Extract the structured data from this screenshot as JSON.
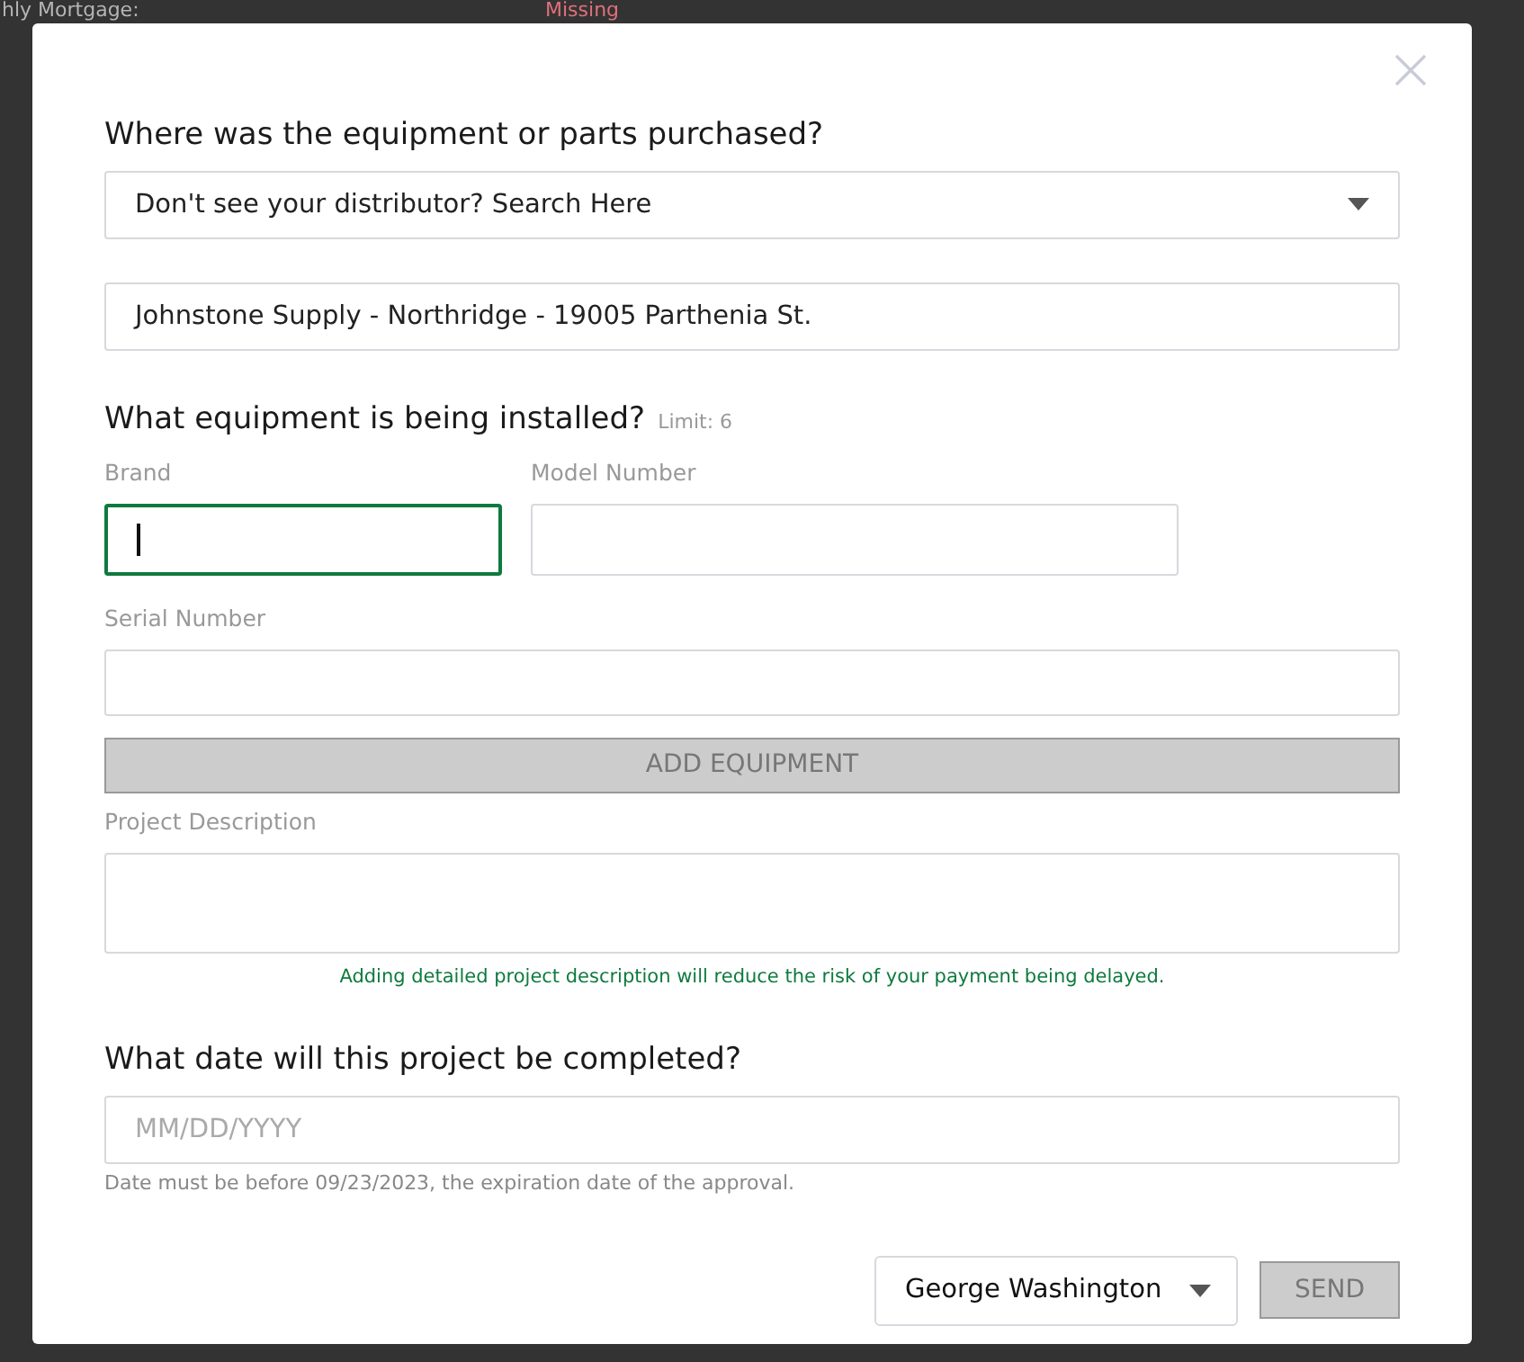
{
  "background": {
    "label": "hly Mortgage:",
    "status": "Missing"
  },
  "purchase": {
    "heading": "Where was the equipment or parts purchased?",
    "distributor_select": "Don't see your distributor? Search Here",
    "distributor_value": "Johnstone Supply - Northridge - 19005 Parthenia St."
  },
  "equipment": {
    "heading": "What equipment is being installed?",
    "limit": "Limit: 6",
    "fields": [
      {
        "label": "Brand",
        "focused": true
      },
      {
        "label": "Model Number",
        "focused": false
      },
      {
        "label": "Serial Number",
        "focused": false
      }
    ],
    "add_button": {
      "label": "ADD EQUIPMENT",
      "disabled": true
    }
  },
  "description": {
    "label": "Project Description",
    "hint": "Adding detailed project description will reduce the risk of your payment being delayed."
  },
  "completion": {
    "heading": "What date will this project be completed?",
    "placeholder": "MM/DD/YYYY",
    "note": "Date must be before 09/23/2023, the expiration date of the approval."
  },
  "footer": {
    "person": "George Washington",
    "send": {
      "label": "SEND",
      "disabled": true
    }
  }
}
